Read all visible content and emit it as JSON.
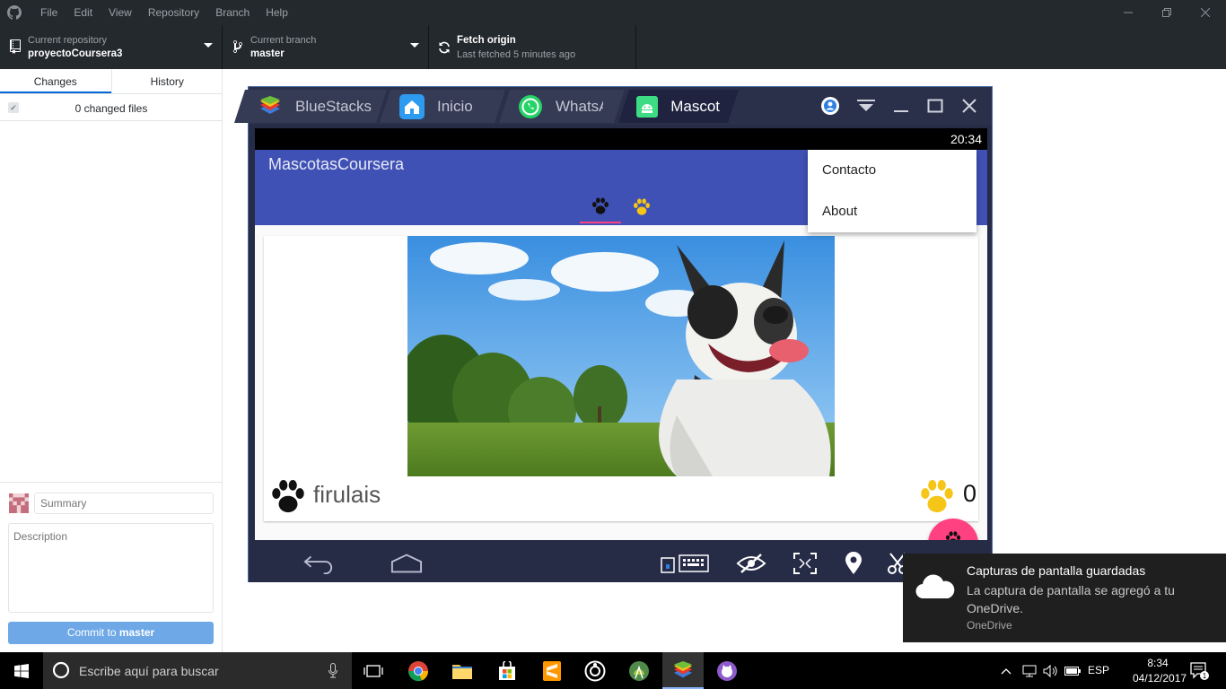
{
  "titlebar": {
    "menu": [
      "File",
      "Edit",
      "View",
      "Repository",
      "Branch",
      "Help"
    ]
  },
  "toolbar": {
    "repo_label": "Current repository",
    "repo_value": "proyectoCoursera3",
    "branch_label": "Current branch",
    "branch_value": "master",
    "fetch_label": "Fetch origin",
    "fetch_sub": "Last fetched 5 minutes ago"
  },
  "sidebar": {
    "tabs": [
      "Changes",
      "History"
    ],
    "changed_files": "0 changed files",
    "summary_placeholder": "Summary",
    "description_placeholder": "Description",
    "commit_prefix": "Commit to ",
    "commit_branch": "master"
  },
  "bluestacks": {
    "tabs": [
      "BlueStacks",
      "Inicio",
      "WhatsA",
      "Mascot"
    ],
    "android": {
      "clock": "20:34",
      "app_title": "MascotasCoursera",
      "menu": [
        "Contacto",
        "About"
      ],
      "pet_name": "firulais",
      "likes": "0"
    }
  },
  "toast": {
    "title": "Capturas de pantalla guardadas",
    "body": "La captura de pantalla se agregó a tu OneDrive.",
    "source": "OneDrive"
  },
  "taskbar": {
    "search_placeholder": "Escribe aquí para buscar",
    "lang": "ESP",
    "time": "8:34",
    "date": "04/12/2017",
    "notif_count": "1"
  },
  "colors": {
    "appbar": "#3f51b5",
    "accent": "#ff4081",
    "paw_yellow": "#f5c518",
    "commit_button": "#6ea8e7"
  }
}
